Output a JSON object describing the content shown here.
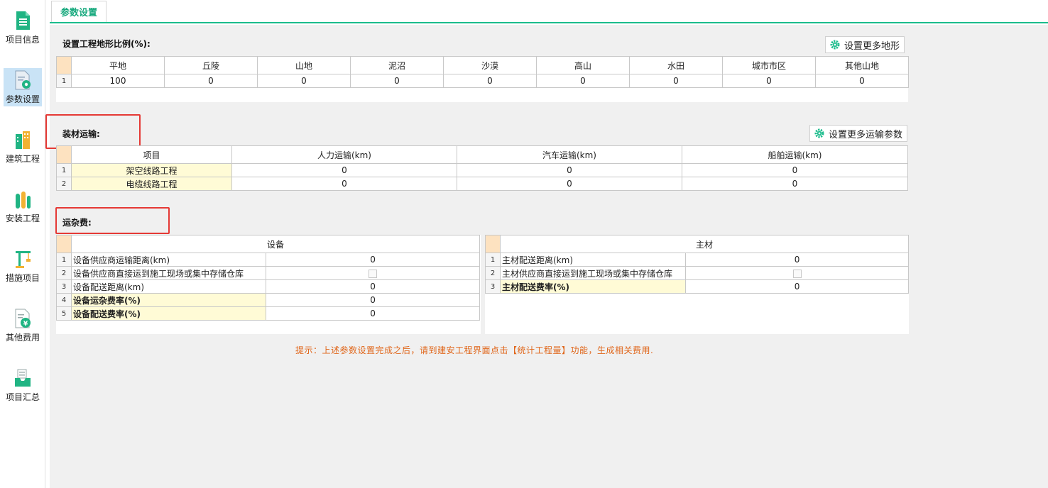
{
  "sidebar": {
    "items": [
      {
        "label": "项目信息",
        "icon": "document-icon"
      },
      {
        "label": "参数设置",
        "icon": "settings-document-icon",
        "active": true
      },
      {
        "label": "建筑工程",
        "icon": "building-icon"
      },
      {
        "label": "安装工程",
        "icon": "factory-icon"
      },
      {
        "label": "措施项目",
        "icon": "crane-icon"
      },
      {
        "label": "其他费用",
        "icon": "yuan-document-icon"
      },
      {
        "label": "项目汇总",
        "icon": "inbox-icon"
      }
    ]
  },
  "tabs": [
    {
      "label": "参数设置",
      "active": true
    }
  ],
  "terrain": {
    "title": "设置工程地形比例(%):",
    "button": "设置更多地形",
    "headers": [
      "平地",
      "丘陵",
      "山地",
      "泥沼",
      "沙漠",
      "高山",
      "水田",
      "城市市区",
      "其他山地"
    ],
    "rows": [
      [
        "1",
        "100",
        "0",
        "0",
        "0",
        "0",
        "0",
        "0",
        "0",
        "0"
      ]
    ]
  },
  "transport": {
    "title": "装材运输:",
    "button": "设置更多运输参数",
    "headers": [
      "项目",
      "人力运输(km)",
      "汽车运输(km)",
      "船舶运输(km)"
    ],
    "rows": [
      [
        "1",
        "架空线路工程",
        "0",
        "0",
        "0"
      ],
      [
        "2",
        "电缆线路工程",
        "0",
        "0",
        "0"
      ]
    ]
  },
  "misc": {
    "title": "运杂费:",
    "equipment": {
      "header": "设备",
      "rows": [
        {
          "no": "1",
          "name": "设备供应商运输距离(km)",
          "value": "0",
          "type": "text"
        },
        {
          "no": "2",
          "name": "设备供应商直接运到施工现场或集中存储仓库",
          "value": "",
          "type": "checkbox"
        },
        {
          "no": "3",
          "name": "设备配送距离(km)",
          "value": "0",
          "type": "text"
        },
        {
          "no": "4",
          "name": "设备运杂费率(%)",
          "value": "0",
          "type": "text",
          "bold": true
        },
        {
          "no": "5",
          "name": "设备配送费率(%)",
          "value": "0",
          "type": "text",
          "bold": true
        }
      ]
    },
    "material": {
      "header": "主材",
      "rows": [
        {
          "no": "1",
          "name": "主材配送距离(km)",
          "value": "0",
          "type": "text"
        },
        {
          "no": "2",
          "name": "主材供应商直接运到施工现场或集中存储仓库",
          "value": "",
          "type": "checkbox"
        },
        {
          "no": "3",
          "name": "主材配送费率(%)",
          "value": "0",
          "type": "text",
          "bold": true
        }
      ]
    }
  },
  "hint": "提示：上述参数设置完成之后，请到建安工程界面点击【统计工程量】功能，生成相关费用.",
  "colors": {
    "accent": "#1bbc8c",
    "highlight": "#e53935",
    "hint": "#e0661a",
    "yellow_cell": "#fffbd6",
    "corner": "#fde2c0"
  }
}
